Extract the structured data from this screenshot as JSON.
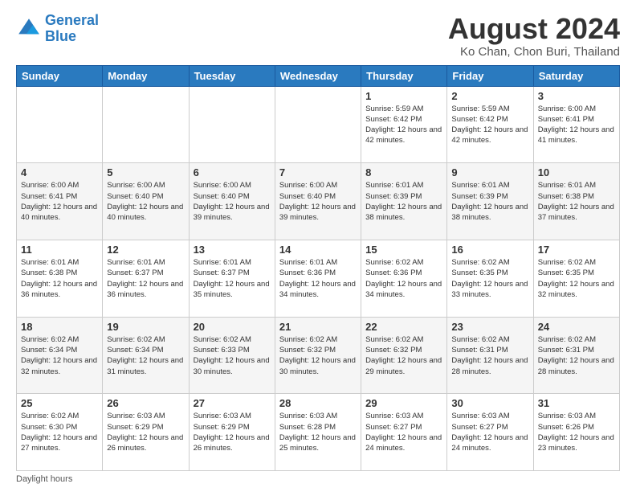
{
  "header": {
    "logo_line1": "General",
    "logo_line2": "Blue",
    "main_title": "August 2024",
    "subtitle": "Ko Chan, Chon Buri, Thailand"
  },
  "days_of_week": [
    "Sunday",
    "Monday",
    "Tuesday",
    "Wednesday",
    "Thursday",
    "Friday",
    "Saturday"
  ],
  "weeks": [
    [
      {
        "day": "",
        "info": ""
      },
      {
        "day": "",
        "info": ""
      },
      {
        "day": "",
        "info": ""
      },
      {
        "day": "",
        "info": ""
      },
      {
        "day": "1",
        "info": "Sunrise: 5:59 AM\nSunset: 6:42 PM\nDaylight: 12 hours\nand 42 minutes."
      },
      {
        "day": "2",
        "info": "Sunrise: 5:59 AM\nSunset: 6:42 PM\nDaylight: 12 hours\nand 42 minutes."
      },
      {
        "day": "3",
        "info": "Sunrise: 6:00 AM\nSunset: 6:41 PM\nDaylight: 12 hours\nand 41 minutes."
      }
    ],
    [
      {
        "day": "4",
        "info": "Sunrise: 6:00 AM\nSunset: 6:41 PM\nDaylight: 12 hours\nand 40 minutes."
      },
      {
        "day": "5",
        "info": "Sunrise: 6:00 AM\nSunset: 6:40 PM\nDaylight: 12 hours\nand 40 minutes."
      },
      {
        "day": "6",
        "info": "Sunrise: 6:00 AM\nSunset: 6:40 PM\nDaylight: 12 hours\nand 39 minutes."
      },
      {
        "day": "7",
        "info": "Sunrise: 6:00 AM\nSunset: 6:40 PM\nDaylight: 12 hours\nand 39 minutes."
      },
      {
        "day": "8",
        "info": "Sunrise: 6:01 AM\nSunset: 6:39 PM\nDaylight: 12 hours\nand 38 minutes."
      },
      {
        "day": "9",
        "info": "Sunrise: 6:01 AM\nSunset: 6:39 PM\nDaylight: 12 hours\nand 38 minutes."
      },
      {
        "day": "10",
        "info": "Sunrise: 6:01 AM\nSunset: 6:38 PM\nDaylight: 12 hours\nand 37 minutes."
      }
    ],
    [
      {
        "day": "11",
        "info": "Sunrise: 6:01 AM\nSunset: 6:38 PM\nDaylight: 12 hours\nand 36 minutes."
      },
      {
        "day": "12",
        "info": "Sunrise: 6:01 AM\nSunset: 6:37 PM\nDaylight: 12 hours\nand 36 minutes."
      },
      {
        "day": "13",
        "info": "Sunrise: 6:01 AM\nSunset: 6:37 PM\nDaylight: 12 hours\nand 35 minutes."
      },
      {
        "day": "14",
        "info": "Sunrise: 6:01 AM\nSunset: 6:36 PM\nDaylight: 12 hours\nand 34 minutes."
      },
      {
        "day": "15",
        "info": "Sunrise: 6:02 AM\nSunset: 6:36 PM\nDaylight: 12 hours\nand 34 minutes."
      },
      {
        "day": "16",
        "info": "Sunrise: 6:02 AM\nSunset: 6:35 PM\nDaylight: 12 hours\nand 33 minutes."
      },
      {
        "day": "17",
        "info": "Sunrise: 6:02 AM\nSunset: 6:35 PM\nDaylight: 12 hours\nand 32 minutes."
      }
    ],
    [
      {
        "day": "18",
        "info": "Sunrise: 6:02 AM\nSunset: 6:34 PM\nDaylight: 12 hours\nand 32 minutes."
      },
      {
        "day": "19",
        "info": "Sunrise: 6:02 AM\nSunset: 6:34 PM\nDaylight: 12 hours\nand 31 minutes."
      },
      {
        "day": "20",
        "info": "Sunrise: 6:02 AM\nSunset: 6:33 PM\nDaylight: 12 hours\nand 30 minutes."
      },
      {
        "day": "21",
        "info": "Sunrise: 6:02 AM\nSunset: 6:32 PM\nDaylight: 12 hours\nand 30 minutes."
      },
      {
        "day": "22",
        "info": "Sunrise: 6:02 AM\nSunset: 6:32 PM\nDaylight: 12 hours\nand 29 minutes."
      },
      {
        "day": "23",
        "info": "Sunrise: 6:02 AM\nSunset: 6:31 PM\nDaylight: 12 hours\nand 28 minutes."
      },
      {
        "day": "24",
        "info": "Sunrise: 6:02 AM\nSunset: 6:31 PM\nDaylight: 12 hours\nand 28 minutes."
      }
    ],
    [
      {
        "day": "25",
        "info": "Sunrise: 6:02 AM\nSunset: 6:30 PM\nDaylight: 12 hours\nand 27 minutes."
      },
      {
        "day": "26",
        "info": "Sunrise: 6:03 AM\nSunset: 6:29 PM\nDaylight: 12 hours\nand 26 minutes."
      },
      {
        "day": "27",
        "info": "Sunrise: 6:03 AM\nSunset: 6:29 PM\nDaylight: 12 hours\nand 26 minutes."
      },
      {
        "day": "28",
        "info": "Sunrise: 6:03 AM\nSunset: 6:28 PM\nDaylight: 12 hours\nand 25 minutes."
      },
      {
        "day": "29",
        "info": "Sunrise: 6:03 AM\nSunset: 6:27 PM\nDaylight: 12 hours\nand 24 minutes."
      },
      {
        "day": "30",
        "info": "Sunrise: 6:03 AM\nSunset: 6:27 PM\nDaylight: 12 hours\nand 24 minutes."
      },
      {
        "day": "31",
        "info": "Sunrise: 6:03 AM\nSunset: 6:26 PM\nDaylight: 12 hours\nand 23 minutes."
      }
    ]
  ],
  "footer": {
    "daylight_hours_label": "Daylight hours"
  }
}
